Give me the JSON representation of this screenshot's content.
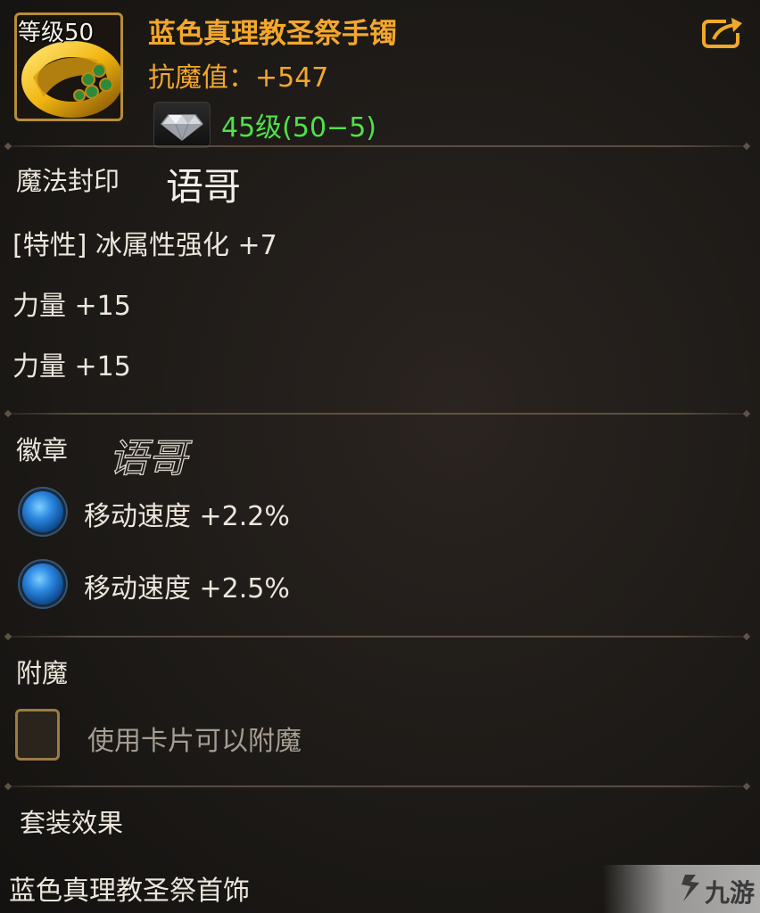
{
  "item": {
    "level_badge": "等级50",
    "name": "蓝色真理教圣祭手镯",
    "resist_label": "抗魔值：+547",
    "gem_level": "45级(50−5)",
    "icon": "bracelet-icon",
    "gem_icon": "diamond-icon",
    "share_icon": "share-icon"
  },
  "magic_seal": {
    "title": "魔法封印",
    "watermark": "语哥",
    "trait": "[特性] 冰属性强化 +7",
    "stats": [
      "力量 +15",
      "力量 +15"
    ]
  },
  "emblem": {
    "title": "徽章",
    "watermark": "语哥",
    "stats": [
      "移动速度 +2.2%",
      "移动速度 +2.5%"
    ]
  },
  "enchant": {
    "title": "附魔",
    "hint": "使用卡片可以附魔"
  },
  "set_effect": {
    "title": "套装效果",
    "set_name": "蓝色真理教圣祭首饰"
  },
  "logo": {
    "text": "九游"
  },
  "colors": {
    "name": "#f3a72c",
    "gem_level": "#4fe24a",
    "badge": "#2d88e0"
  }
}
